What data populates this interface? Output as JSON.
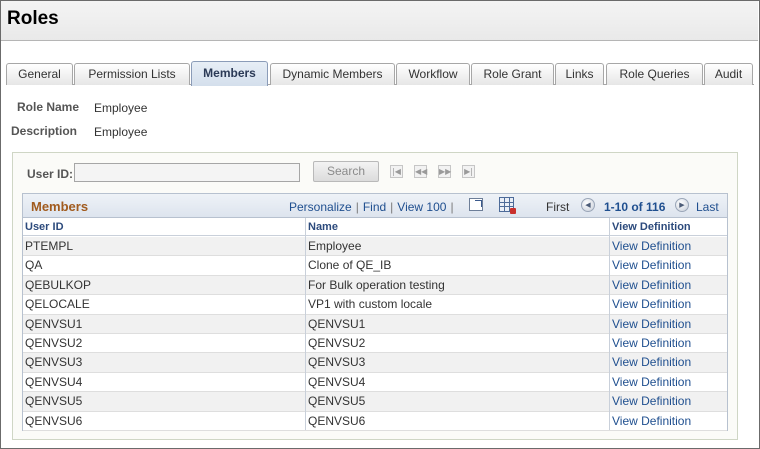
{
  "page": {
    "title": "Roles"
  },
  "tabs": [
    {
      "label": "General"
    },
    {
      "label": "Permission Lists"
    },
    {
      "label": "Members"
    },
    {
      "label": "Dynamic Members"
    },
    {
      "label": "Workflow"
    },
    {
      "label": "Role Grant"
    },
    {
      "label": "Links"
    },
    {
      "label": "Role Queries"
    },
    {
      "label": "Audit"
    }
  ],
  "active_tab": "Members",
  "role": {
    "name_label": "Role Name",
    "name_value": "Employee",
    "description_label": "Description",
    "description_value": "Employee"
  },
  "search": {
    "label": "User ID:",
    "value": "",
    "button_label": "Search",
    "nav_icons": [
      "first-page-icon",
      "prev-page-icon",
      "next-page-icon",
      "last-page-icon"
    ]
  },
  "grid": {
    "title": "Members",
    "links": {
      "personalize": "Personalize",
      "find": "Find",
      "view_all": "View 100",
      "sep": "|"
    },
    "pager": {
      "first": "First",
      "range": "1-10 of 116",
      "last": "Last"
    },
    "columns": [
      "User ID",
      "Name",
      "View Definition"
    ],
    "rows": [
      {
        "user_id": "PTEMPL",
        "name": "Employee",
        "link": "View Definition"
      },
      {
        "user_id": "QA",
        "name": "Clone of QE_IB",
        "link": "View Definition"
      },
      {
        "user_id": "QEBULKOP",
        "name": "For Bulk operation testing",
        "link": "View Definition"
      },
      {
        "user_id": "QELOCALE",
        "name": "VP1 with custom locale",
        "link": "View Definition"
      },
      {
        "user_id": "QENVSU1",
        "name": "QENVSU1",
        "link": "View Definition"
      },
      {
        "user_id": "QENVSU2",
        "name": "QENVSU2",
        "link": "View Definition"
      },
      {
        "user_id": "QENVSU3",
        "name": "QENVSU3",
        "link": "View Definition"
      },
      {
        "user_id": "QENVSU4",
        "name": "QENVSU4",
        "link": "View Definition"
      },
      {
        "user_id": "QENVSU5",
        "name": "QENVSU5",
        "link": "View Definition"
      },
      {
        "user_id": "QENVSU6",
        "name": "QENVSU6",
        "link": "View Definition"
      }
    ]
  },
  "colors": {
    "accent_title": "#a15b1e",
    "link": "#1f4f8f",
    "active_tab_bg": "#d4dfec"
  }
}
